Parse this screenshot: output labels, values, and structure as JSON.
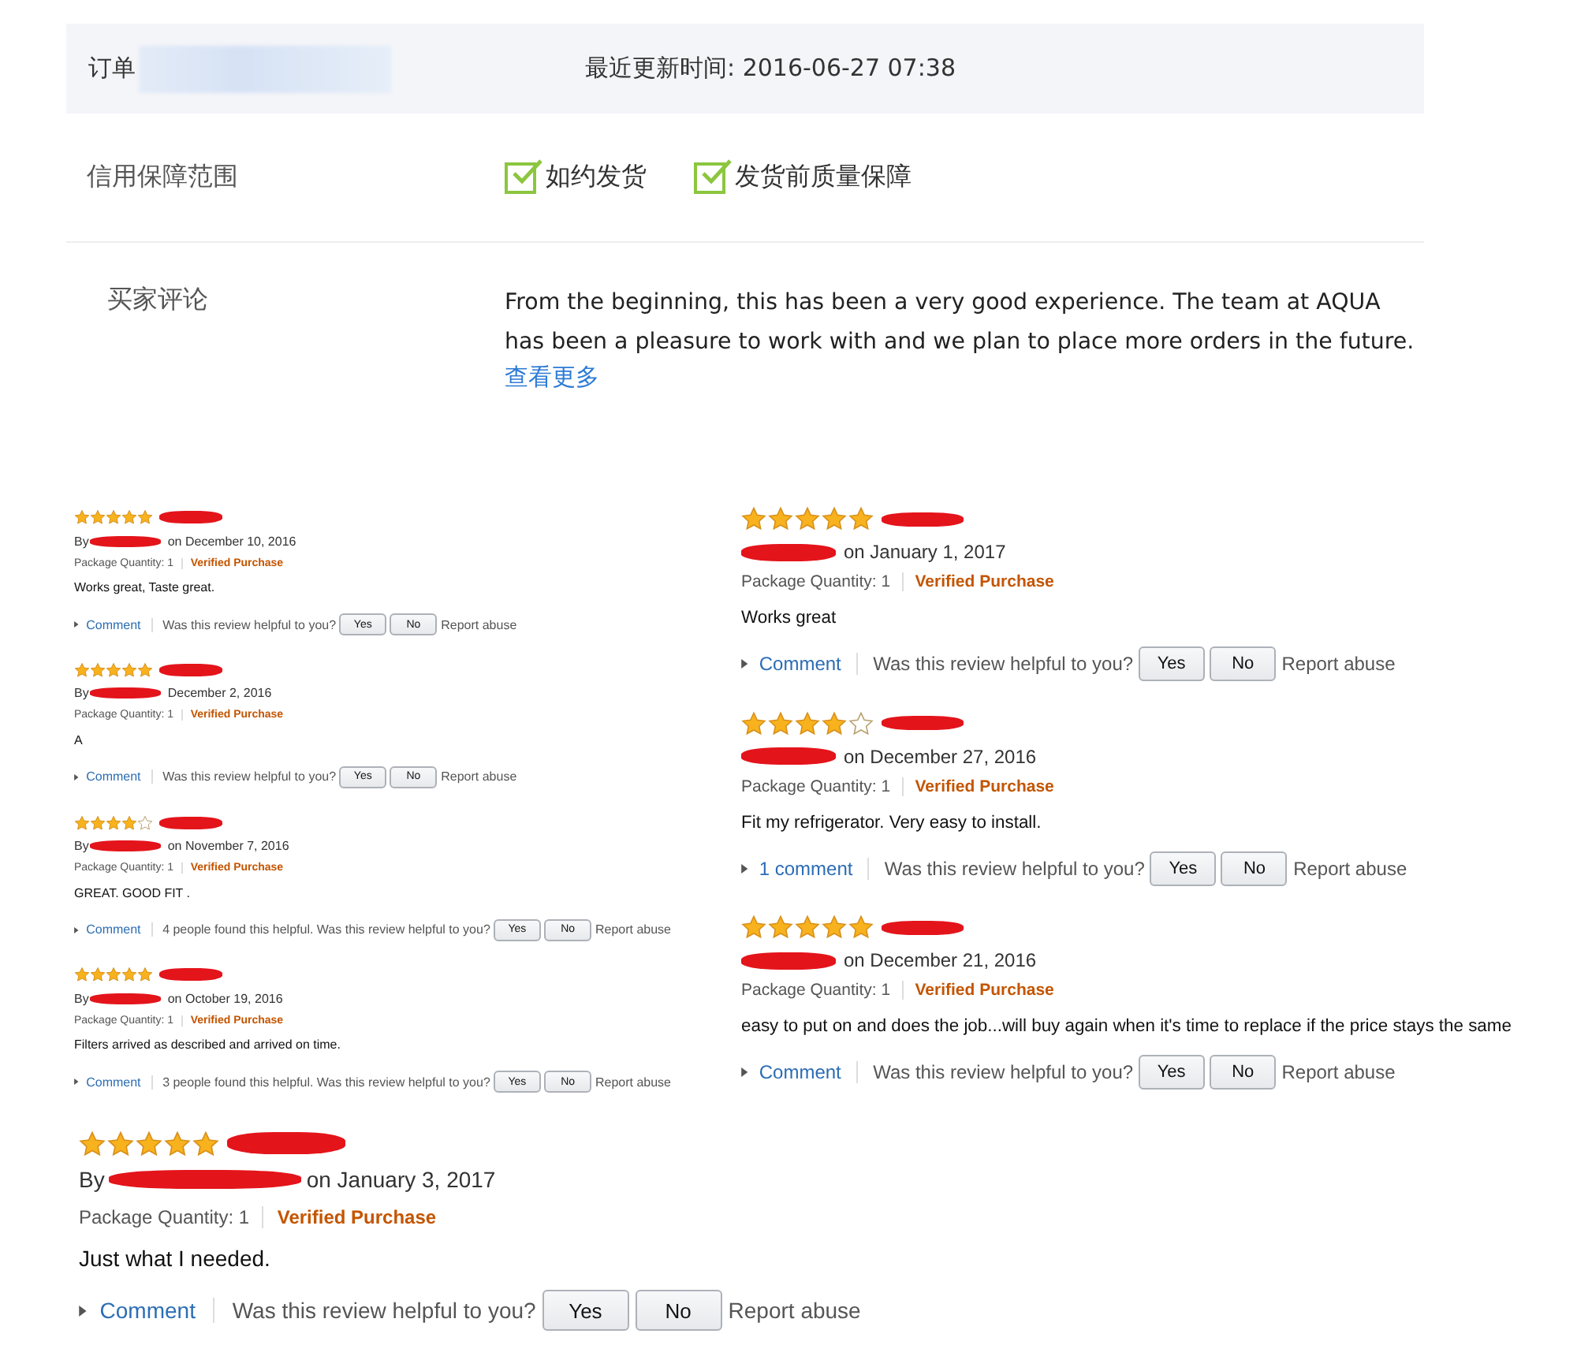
{
  "order": {
    "label": "订单",
    "updated": "最近更新时间: 2016-06-27 07:38"
  },
  "guarantee": {
    "label": "信用保障范围",
    "items": [
      {
        "text": "如约发货",
        "checked": true
      },
      {
        "text": "发货前质量保障",
        "checked": true
      }
    ]
  },
  "buyer_comment": {
    "label": "买家评论",
    "text": "From the beginning, this has been a very good experience. The team at AQUA has been a pleasure to work with and we plan to place more orders in the future.",
    "more": "查看更多"
  },
  "review_groups": [
    {
      "kind": "small",
      "reviews": [
        {
          "stars": 5,
          "by": "By",
          "date": "on December 10, 2016",
          "quantity": "Package Quantity: 1",
          "verified": "Verified Purchase",
          "body": "Works great, Taste great.",
          "comment": "Comment",
          "question": "Was this review helpful to you?",
          "yes": "Yes",
          "no": "No",
          "report": "Report abuse"
        },
        {
          "stars": 5,
          "by": "By",
          "date": "December 2, 2016",
          "quantity": "Package Quantity: 1",
          "verified": "Verified Purchase",
          "body": "A",
          "comment": "Comment",
          "question": "Was this review helpful to you?",
          "yes": "Yes",
          "no": "No",
          "report": "Report abuse"
        },
        {
          "stars": 4,
          "by": "By",
          "date": "on November 7, 2016",
          "quantity": "Package Quantity: 1",
          "verified": "Verified Purchase",
          "body": "GREAT. GOOD FIT .",
          "comment": "Comment",
          "question": "4 people found this helpful. Was this review helpful to you?",
          "yes": "Yes",
          "no": "No",
          "report": "Report abuse"
        },
        {
          "stars": 5,
          "by": "By",
          "date": "on October 19, 2016",
          "quantity": "Package Quantity: 1",
          "verified": "Verified Purchase",
          "body": "Filters arrived as described and arrived on time.",
          "comment": "Comment",
          "question": "3 people found this helpful. Was this review helpful to you?",
          "yes": "Yes",
          "no": "No",
          "report": "Report abuse"
        }
      ]
    },
    {
      "kind": "medium",
      "reviews": [
        {
          "stars": 5,
          "date": "on January 1, 2017",
          "quantity": "Package Quantity: 1",
          "verified": "Verified Purchase",
          "body": "Works great",
          "comment": "Comment",
          "question": "Was this review helpful to you?",
          "yes": "Yes",
          "no": "No",
          "report": "Report abuse"
        },
        {
          "stars": 4,
          "date": "on December 27, 2016",
          "quantity": "Package Quantity: 1",
          "verified": "Verified Purchase",
          "body": "Fit my refrigerator. Very easy to install.",
          "comment": "1 comment",
          "question": "Was this review helpful to you?",
          "yes": "Yes",
          "no": "No",
          "report": "Report abuse"
        },
        {
          "stars": 5,
          "date": "on December 21, 2016",
          "quantity": "Package Quantity: 1",
          "verified": "Verified Purchase",
          "body": "easy to put on and does the job...will buy again when it's time to replace if the price stays the same",
          "comment": "Comment",
          "question": "Was this review helpful to you?",
          "yes": "Yes",
          "no": "No",
          "report": "Report abuse"
        }
      ]
    },
    {
      "kind": "large",
      "reviews": [
        {
          "stars": 5,
          "by": "By",
          "date": "on January 3, 2017",
          "quantity": "Package Quantity: 1",
          "verified": "Verified Purchase",
          "body": "Just what I needed.",
          "comment": "Comment",
          "question": "Was this review helpful to you?",
          "yes": "Yes",
          "no": "No",
          "report": "Report abuse"
        }
      ]
    }
  ]
}
